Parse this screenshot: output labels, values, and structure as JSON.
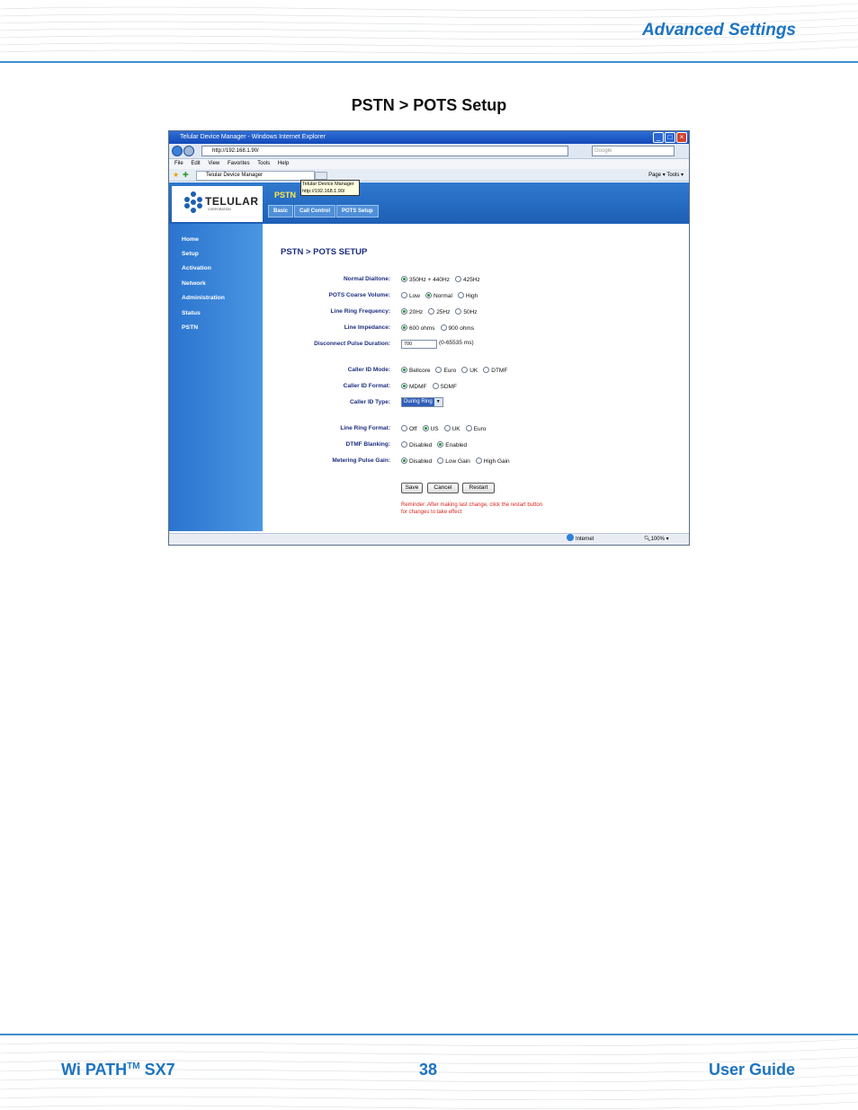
{
  "document": {
    "section_title": "Advanced Settings",
    "page_heading": "PSTN > POTS Setup",
    "footer": {
      "product_name": "Wi PATH",
      "product_tm": "TM",
      "product_model": "SX7",
      "page_number": "38",
      "guide_label": "User Guide"
    }
  },
  "browser": {
    "window_title": "Telular Device Manager - Windows Internet Explorer",
    "address": "http://192.168.1.90/",
    "search_placeholder": "Google",
    "menu": [
      "File",
      "Edit",
      "View",
      "Favorites",
      "Tools",
      "Help"
    ],
    "tab_title": "Telular Device Manager",
    "toolbar_right": "Page ▾  Tools ▾",
    "tooltip_line1": "Telular Device Manager",
    "tooltip_line2": "http://192.168.1.90/",
    "status_zone": "Internet",
    "zoom": "100%"
  },
  "site": {
    "logo_text": "TELULAR",
    "logo_sub": "CORPORATION",
    "section": "PSTN",
    "subtabs": [
      "Basic",
      "Call Control",
      "POTS Setup"
    ],
    "sidebar": [
      "Home",
      "Setup",
      "Activation",
      "Network",
      "Administration",
      "Status",
      "PSTN"
    ],
    "content_title": "PSTN > POTS SETUP",
    "fields": {
      "normal_dialtone": {
        "label": "Normal Dialtone:",
        "options": [
          "350Hz + 440Hz",
          "425Hz"
        ],
        "selected": 0
      },
      "coarse_volume": {
        "label": "POTS Coarse Volume:",
        "options": [
          "Low",
          "Normal",
          "High"
        ],
        "selected": 1
      },
      "ring_frequency": {
        "label": "Line Ring Frequency:",
        "options": [
          "20Hz",
          "25Hz",
          "50Hz"
        ],
        "selected": 0
      },
      "line_impedance": {
        "label": "Line Impedance:",
        "options": [
          "600 ohms",
          "900 ohms"
        ],
        "selected": 0
      },
      "disconnect_pulse": {
        "label": "Disconnect Pulse Duration:",
        "value": "700",
        "range": "(0-65535 ms)"
      },
      "caller_id_mode": {
        "label": "Caller ID Mode:",
        "options": [
          "Bellcore",
          "Euro",
          "UK",
          "DTMF"
        ],
        "selected": 0
      },
      "caller_id_format": {
        "label": "Caller ID Format:",
        "options": [
          "MDMF",
          "SDMF"
        ],
        "selected": 0
      },
      "caller_id_type": {
        "label": "Caller  ID Type:",
        "value": "During Ring"
      },
      "ring_format": {
        "label": "Line Ring Format:",
        "options": [
          "Off",
          "US",
          "UK",
          "Euro"
        ],
        "selected": 1
      },
      "dtmf_blanking": {
        "label": "DTMF Blanking:",
        "options": [
          "Disabled",
          "Enabled"
        ],
        "selected": 1
      },
      "metering_gain": {
        "label": "Metering Pulse Gain:",
        "options": [
          "Disabled",
          "Low Gain",
          "High Gain"
        ],
        "selected": 0
      }
    },
    "buttons": {
      "save": "Save",
      "cancel": "Cancel",
      "restart": "Restart"
    },
    "reminder": "Reminder: After making last change, click the restart button for changes to take effect"
  },
  "colors": {
    "accent_blue": "#1d74c2",
    "label_navy": "#1c2e80",
    "reminder_red": "#d8261f",
    "pstn_yellow": "#ffe94a"
  }
}
